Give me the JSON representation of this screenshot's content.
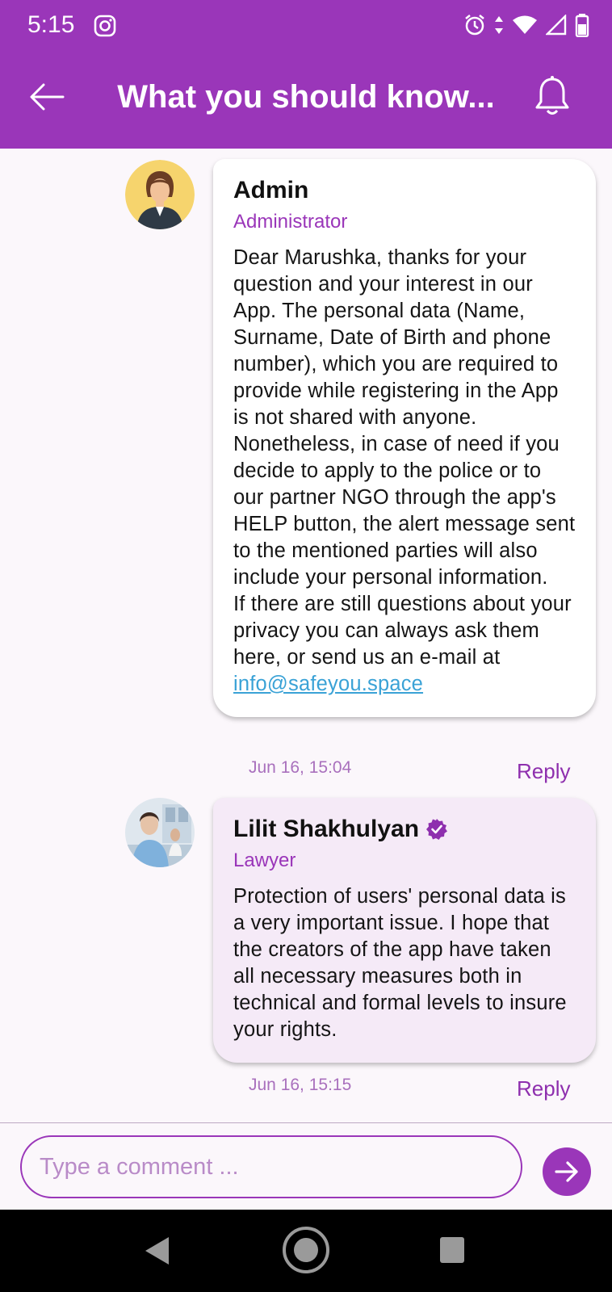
{
  "status_bar": {
    "time": "5:15"
  },
  "header": {
    "title": "What you should know..."
  },
  "comments": [
    {
      "author": "Admin",
      "role": "Administrator",
      "body": "Dear Marushka, thanks for your question and your interest in our App. The personal data (Name, Surname, Date of Birth and phone number), which you are required to provide while registering in the App is not shared with anyone. Nonetheless, in case of need if you decide to apply to the police or to our partner NGO through the app's HELP button, the alert message sent to the mentioned parties will also include your personal information.",
      "body2": "If there are still questions about your privacy you can always ask them here, or send us an e-mail at",
      "email": "info@safeyou.space",
      "date": "Jun 16, 15:04",
      "reply_label": "Reply"
    },
    {
      "author": "Lilit Shakhulyan",
      "role": "Lawyer",
      "body": "Protection of users' personal data is a very important issue. I hope that the creators of the app have taken all necessary measures both in technical and formal levels to insure your rights.",
      "date": "Jun 16, 15:15",
      "reply_label": "Reply"
    }
  ],
  "composer": {
    "placeholder": "Type a comment ..."
  },
  "colors": {
    "accent": "#9a36b9",
    "link": "#3aa2d6",
    "bubble_lilac": "#f5eaf7"
  }
}
